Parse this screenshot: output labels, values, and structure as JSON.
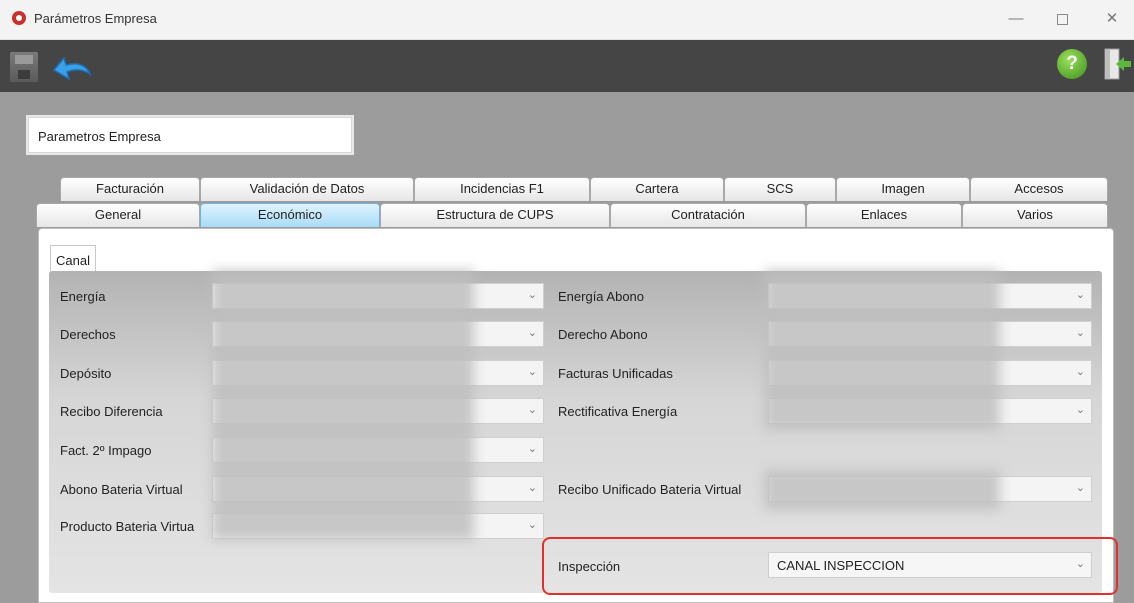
{
  "window": {
    "title": "Parámetros Empresa",
    "minimize_glyph": "—",
    "close_glyph": "✕"
  },
  "toolbar": {
    "save_icon": "save-icon",
    "undo_icon": "undo-arrow-icon",
    "help_glyph": "?",
    "exit_icon": "exit-door-icon"
  },
  "header": {
    "company_label": "Parametros Empresa"
  },
  "tabs": {
    "row1": [
      "Facturación",
      "Validación de Datos",
      "Incidencias F1",
      "Cartera",
      "SCS",
      "Imagen",
      "Accesos"
    ],
    "row2": [
      "General",
      "Económico",
      "Estructura de CUPS",
      "Contratación",
      "Enlaces",
      "Varios"
    ],
    "active": "Económico"
  },
  "section": {
    "title": "Canal"
  },
  "fields": {
    "left": [
      "Energía",
      "Derechos",
      "Depósito",
      "Recibo Diferencia",
      "Fact. 2º Impago",
      "Abono Bateria Virtual",
      "Producto Bateria Virtua"
    ],
    "right": [
      "Energía Abono",
      "Derecho Abono",
      "Facturas Unificadas",
      "Rectificativa Energía",
      "Recibo Unificado Bateria Virtual"
    ],
    "inspeccion_label": "Inspección",
    "inspeccion_value": "CANAL INSPECCION",
    "chevron": "⌄"
  },
  "colors": {
    "highlight": "#e0302b",
    "active_tab": "#a9dcf7",
    "toolbar_bg": "#454545"
  }
}
